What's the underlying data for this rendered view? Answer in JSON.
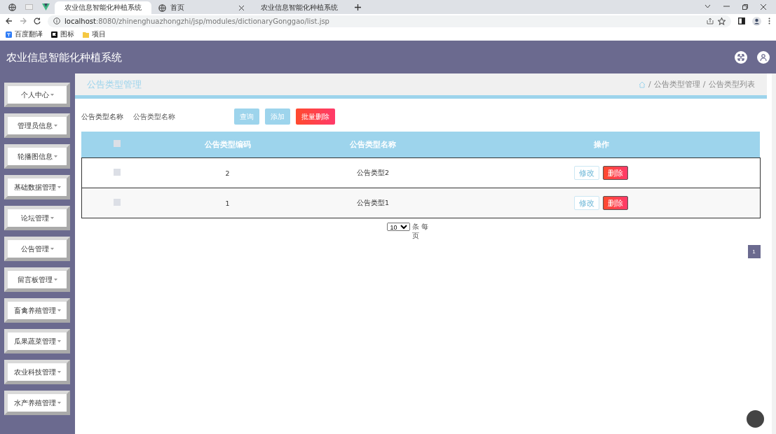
{
  "browser": {
    "tabs": [
      {
        "title": "农业信息智能化种植系统",
        "selected": true
      },
      {
        "title": "首页",
        "selected": false
      },
      {
        "title": "农业信息智能化种植系统",
        "selected": false
      }
    ],
    "address": {
      "host": "localhost",
      "path": ":8080/zhinenghuazhongzhi/jsp/modules/dictionaryGonggao/list.jsp"
    },
    "bookmarks": [
      {
        "label": "百度翻译",
        "kind": "translate"
      },
      {
        "label": "图标",
        "kind": "flag"
      },
      {
        "label": "项目",
        "kind": "folder"
      }
    ]
  },
  "header": {
    "title": "农业信息智能化种植系统"
  },
  "sidebar": {
    "items": [
      "个人中心",
      "管理员信息",
      "轮播图信息",
      "基础数据管理",
      "论坛管理",
      "公告管理",
      "留言板管理",
      "畜禽养殖管理",
      "瓜果蔬菜管理",
      "农业科技管理",
      "水产养殖管理"
    ]
  },
  "page": {
    "title": "公告类型管理",
    "breadcrumb": [
      {
        "separator": "/",
        "label": "公告类型管理"
      },
      {
        "separator": "/",
        "label": "公告类型列表"
      }
    ]
  },
  "search": {
    "label": "公告类型名称",
    "placeholder": "公告类型名称",
    "buttons": [
      {
        "label": "查询",
        "kind": "primary"
      },
      {
        "label": "添加",
        "kind": "primary"
      },
      {
        "label": "批量删除",
        "kind": "danger"
      }
    ]
  },
  "table": {
    "select_all": {
      "checked": false
    },
    "columns": [
      "公告类型编码",
      "公告类型名称",
      "操作"
    ],
    "rows": [
      {
        "checked": false,
        "code": "2",
        "name": "公告类型2",
        "actions": [
          "修改",
          "删除"
        ]
      },
      {
        "checked": false,
        "code": "1",
        "name": "公告类型1",
        "actions": [
          "修改",
          "删除"
        ]
      }
    ]
  },
  "pagination": {
    "page_size": "10",
    "page_size_label": "条 每页",
    "pages": [
      {
        "label": "1",
        "selected": true
      }
    ]
  }
}
